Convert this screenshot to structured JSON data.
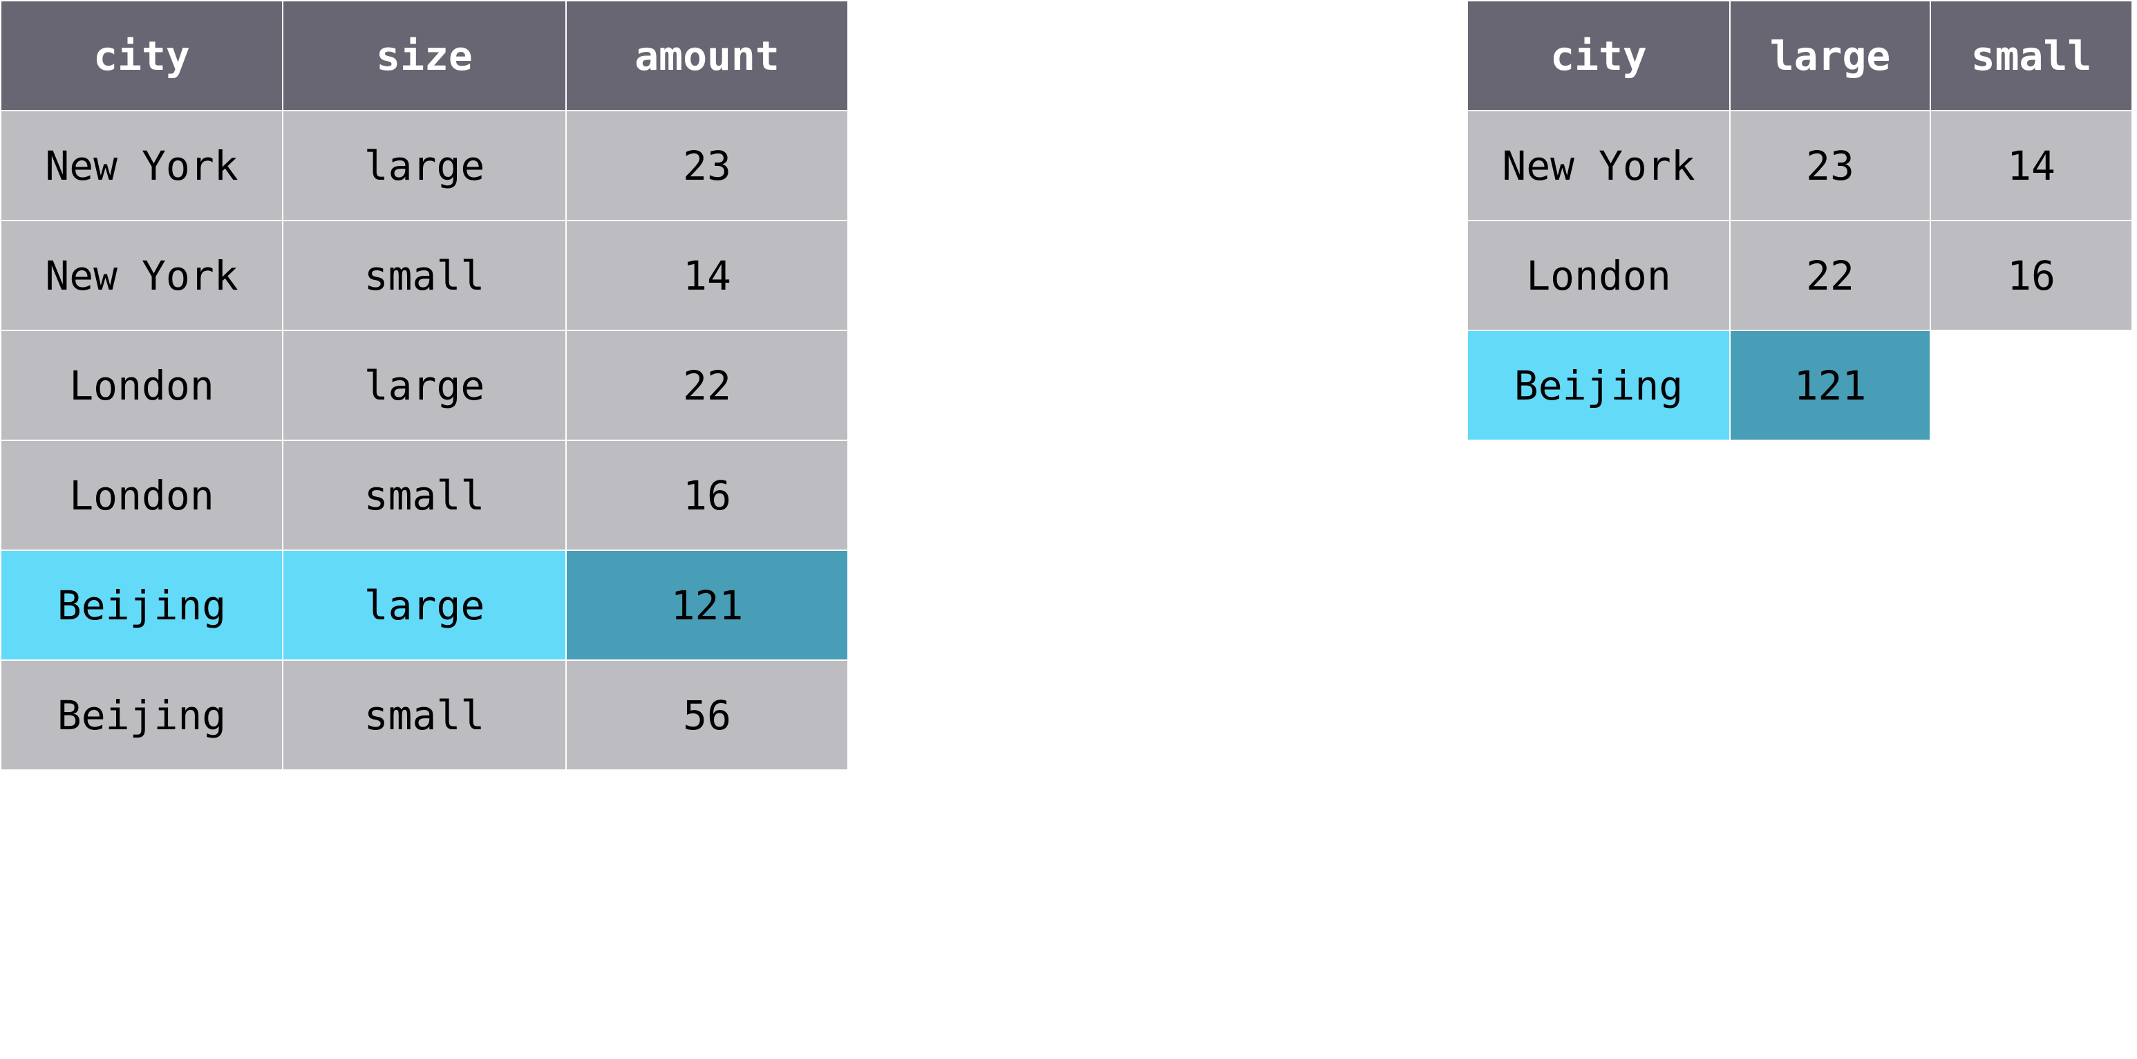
{
  "long_table": {
    "headers": [
      "city",
      "size",
      "amount"
    ],
    "rows": [
      [
        "New York",
        "large",
        "23"
      ],
      [
        "New York",
        "small",
        "14"
      ],
      [
        "London",
        "large",
        "22"
      ],
      [
        "London",
        "small",
        "16"
      ],
      [
        "Beijing",
        "large",
        "121"
      ],
      [
        "Beijing",
        "small",
        "56"
      ]
    ]
  },
  "wide_table": {
    "headers": [
      "city",
      "large",
      "small"
    ],
    "rows": [
      [
        "New York",
        "23",
        "14"
      ],
      [
        "London",
        "22",
        "16"
      ],
      [
        "Beijing",
        "121",
        ""
      ]
    ]
  },
  "colors": {
    "header": "#686672",
    "cell": "#bdbcc1",
    "highlight_key": "#64daf9",
    "highlight_value": "#479eb6"
  }
}
